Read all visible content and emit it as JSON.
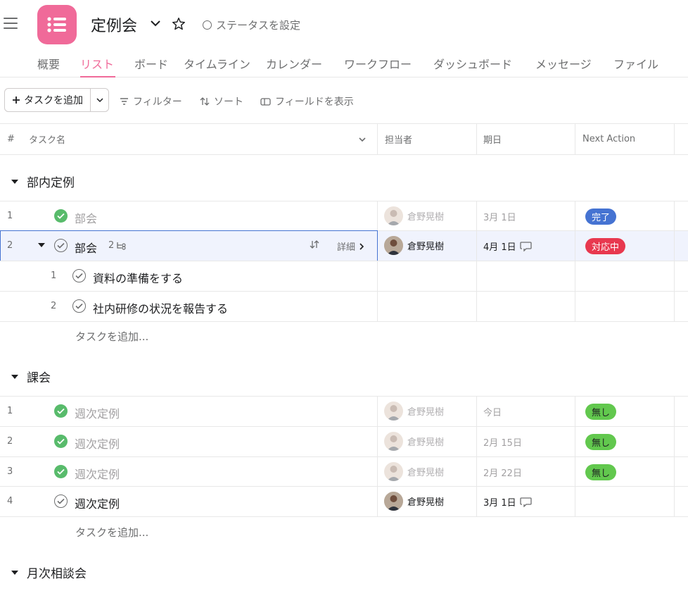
{
  "header": {
    "title": "定例会",
    "status_label": "ステータスを設定"
  },
  "tabs": [
    "概要",
    "リスト",
    "ボード",
    "タイムライン",
    "カレンダー",
    "ワークフロー",
    "ダッシュボード",
    "メッセージ",
    "ファイル"
  ],
  "active_tab": "リスト",
  "toolbar": {
    "add_task": "タスクを追加",
    "filter": "フィルター",
    "sort": "ソート",
    "show_fields": "フィールドを表示"
  },
  "columns": {
    "num": "#",
    "task": "タスク名",
    "assignee": "担当者",
    "due": "期日",
    "next_action": "Next Action"
  },
  "colors": {
    "brand": "#f06a99",
    "done_green": "#58bb6b",
    "badge_blue": "#4573d2",
    "badge_red": "#e8384f",
    "badge_green": "#62c84e",
    "selection": "#4573d2"
  },
  "sections": [
    {
      "title": "部内定例",
      "rows": [
        {
          "num": "1",
          "name": "部会",
          "done": true,
          "assignee": "倉野晃樹",
          "due": "3月 1日",
          "badge": "完了",
          "badge_color": "#4573d2"
        },
        {
          "num": "2",
          "name": "部会",
          "done": false,
          "subtasks": "2",
          "detail": "詳細",
          "assignee": "倉野晃樹",
          "due": "4月 1日",
          "badge": "対応中",
          "badge_color": "#e8384f"
        },
        {
          "num": "1",
          "name": "資料の準備をする",
          "subtask": true
        },
        {
          "num": "2",
          "name": "社内研修の状況を報告する",
          "subtask": true
        }
      ],
      "add_task": "タスクを追加..."
    },
    {
      "title": "課会",
      "rows": [
        {
          "num": "1",
          "name": "週次定例",
          "done": true,
          "assignee": "倉野晃樹",
          "due": "今日",
          "badge": "無し",
          "badge_color": "#62c84e"
        },
        {
          "num": "2",
          "name": "週次定例",
          "done": true,
          "assignee": "倉野晃樹",
          "due": "2月 15日",
          "badge": "無し",
          "badge_color": "#62c84e"
        },
        {
          "num": "3",
          "name": "週次定例",
          "done": true,
          "assignee": "倉野晃樹",
          "due": "2月 22日",
          "badge": "無し",
          "badge_color": "#62c84e"
        },
        {
          "num": "4",
          "name": "週次定例",
          "done": false,
          "assignee": "倉野晃樹",
          "due": "3月 1日"
        }
      ],
      "add_task": "タスクを追加..."
    },
    {
      "title": "月次相談会"
    }
  ]
}
